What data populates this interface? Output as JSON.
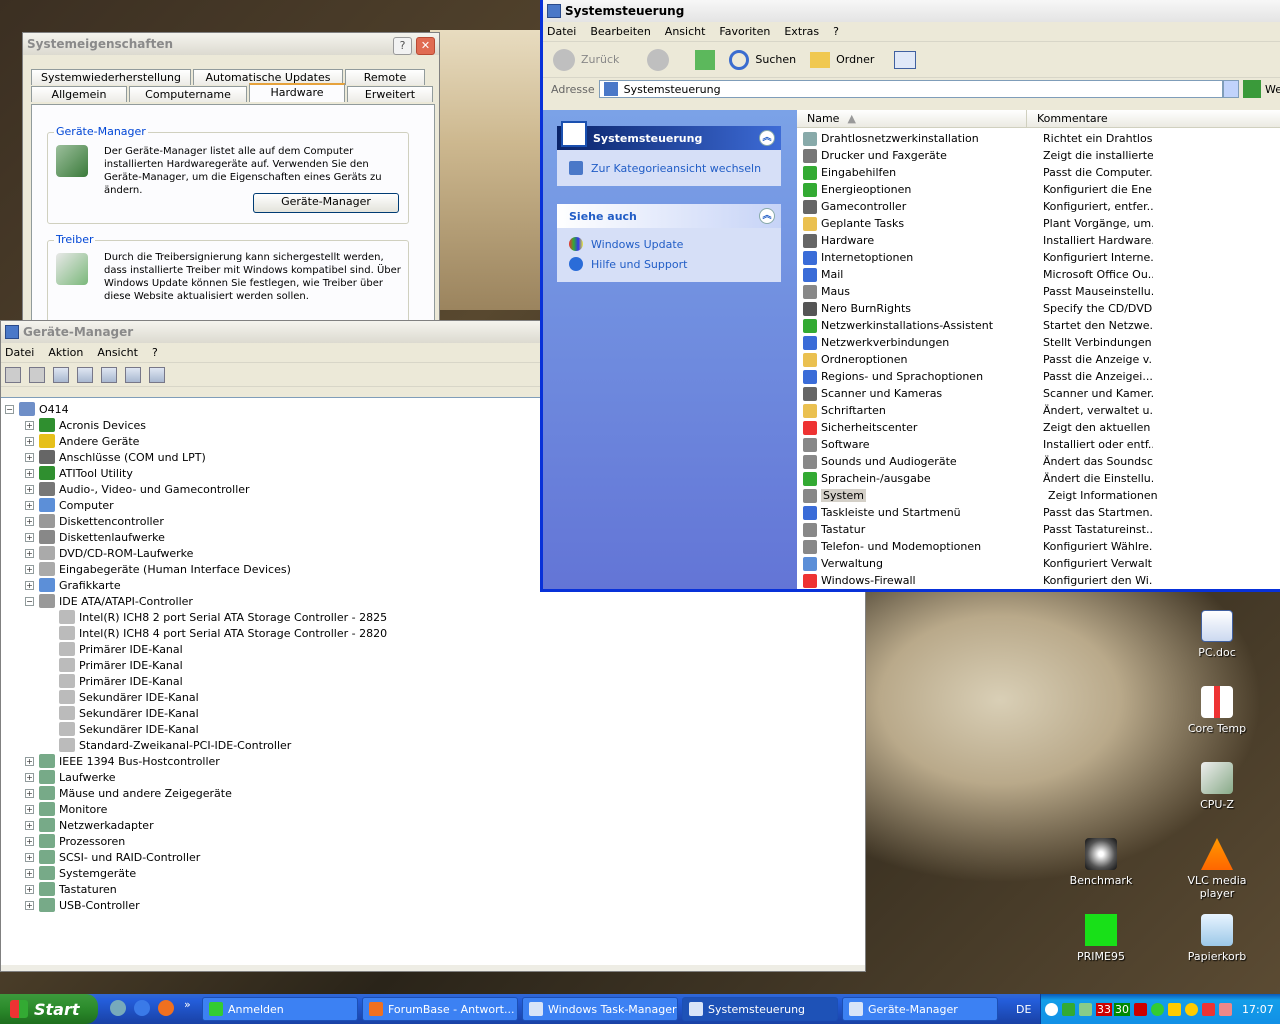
{
  "sysprops": {
    "title": "Systemeigenschaften",
    "tabs_row1": [
      "Systemwiederherstellung",
      "Automatische Updates",
      "Remote"
    ],
    "tabs_row2": [
      "Allgemein",
      "Computername",
      "Hardware",
      "Erweitert"
    ],
    "devmgr_legend": "Geräte-Manager",
    "devmgr_text": "Der Geräte-Manager listet alle auf dem Computer installierten Hardwaregeräte auf. Verwenden Sie den Geräte-Manager, um die Eigenschaften eines Geräts zu ändern.",
    "devmgr_button": "Geräte-Manager",
    "driver_legend": "Treiber",
    "driver_text": "Durch die Treibersignierung kann sichergestellt werden, dass installierte Treiber mit Windows kompatibel sind. Über Windows Update können Sie festlegen, wie Treiber über diese Website aktualisiert werden sollen."
  },
  "devmgr": {
    "title": "Geräte-Manager",
    "menu": [
      "Datei",
      "Aktion",
      "Ansicht",
      "?"
    ],
    "root": "O414",
    "top_categories": [
      "Acronis Devices",
      "Andere Geräte",
      "Anschlüsse (COM und LPT)",
      "ATITool Utility",
      "Audio-, Video- und Gamecontroller",
      "Computer",
      "Diskettencontroller",
      "Diskettenlaufwerke",
      "DVD/CD-ROM-Laufwerke",
      "Eingabegeräte (Human Interface Devices)",
      "Grafikkarte",
      "IDE ATA/ATAPI-Controller"
    ],
    "ide_children": [
      "Intel(R) ICH8 2 port Serial ATA Storage Controller - 2825",
      "Intel(R) ICH8 4 port Serial ATA Storage Controller - 2820",
      "Primärer IDE-Kanal",
      "Primärer IDE-Kanal",
      "Primärer IDE-Kanal",
      "Sekundärer IDE-Kanal",
      "Sekundärer IDE-Kanal",
      "Sekundärer IDE-Kanal",
      "Standard-Zweikanal-PCI-IDE-Controller"
    ],
    "bottom_categories": [
      "IEEE 1394 Bus-Hostcontroller",
      "Laufwerke",
      "Mäuse und andere Zeigegeräte",
      "Monitore",
      "Netzwerkadapter",
      "Prozessoren",
      "SCSI- und RAID-Controller",
      "Systemgeräte",
      "Tastaturen",
      "USB-Controller"
    ]
  },
  "cp": {
    "title": "Systemsteuerung",
    "menu": [
      "Datei",
      "Bearbeiten",
      "Ansicht",
      "Favoriten",
      "Extras",
      "?"
    ],
    "back": "Zurück",
    "search": "Suchen",
    "folders": "Ordner",
    "address_label": "Adresse",
    "address": "Systemsteuerung",
    "go": "We",
    "panel_title": "Systemsteuerung",
    "panel_link": "Zur Kategorieansicht wechseln",
    "see_also": "Siehe auch",
    "see_also_items": [
      "Windows Update",
      "Hilfe und Support"
    ],
    "col_name": "Name",
    "col_comment": "Kommentare",
    "items": [
      {
        "name": "Drahtlosnetzwerkinstallation",
        "comment": "Richtet ein Drahtlos..."
      },
      {
        "name": "Drucker und Faxgeräte",
        "comment": "Zeigt die installierte..."
      },
      {
        "name": "Eingabehilfen",
        "comment": "Passt die Computer..."
      },
      {
        "name": "Energieoptionen",
        "comment": "Konfiguriert die Ene..."
      },
      {
        "name": "Gamecontroller",
        "comment": "Konfiguriert, entfer..."
      },
      {
        "name": "Geplante Tasks",
        "comment": "Plant Vorgänge, um..."
      },
      {
        "name": "Hardware",
        "comment": "Installiert Hardware..."
      },
      {
        "name": "Internetoptionen",
        "comment": "Konfiguriert Interne..."
      },
      {
        "name": "Mail",
        "comment": "Microsoft Office Ou..."
      },
      {
        "name": "Maus",
        "comment": "Passt Mauseinstellu..."
      },
      {
        "name": "Nero BurnRights",
        "comment": "Specify the CD/DVD..."
      },
      {
        "name": "Netzwerkinstallations-Assistent",
        "comment": "Startet den Netzwe..."
      },
      {
        "name": "Netzwerkverbindungen",
        "comment": "Stellt Verbindungen ..."
      },
      {
        "name": "Ordneroptionen",
        "comment": "Passt die Anzeige v..."
      },
      {
        "name": "Regions- und Sprachoptionen",
        "comment": "Passt die Anzeigei..."
      },
      {
        "name": "Scanner und Kameras",
        "comment": "Scanner und Kamer..."
      },
      {
        "name": "Schriftarten",
        "comment": "Ändert, verwaltet u..."
      },
      {
        "name": "Sicherheitscenter",
        "comment": "Zeigt den aktuellen ..."
      },
      {
        "name": "Software",
        "comment": "Installiert oder entf..."
      },
      {
        "name": "Sounds und Audiogeräte",
        "comment": "Ändert das Soundsc..."
      },
      {
        "name": "Sprachein-/ausgabe",
        "comment": "Ändert die Einstellu..."
      },
      {
        "name": "System",
        "comment": "Zeigt Informationen..."
      },
      {
        "name": "Taskleiste und Startmenü",
        "comment": "Passt das Startmen..."
      },
      {
        "name": "Tastatur",
        "comment": "Passt Tastatureinst..."
      },
      {
        "name": "Telefon- und Modemoptionen",
        "comment": "Konfiguriert Wählre..."
      },
      {
        "name": "Verwaltung",
        "comment": "Konfiguriert Verwalt..."
      },
      {
        "name": "Windows-Firewall",
        "comment": "Konfiguriert den Wi..."
      }
    ]
  },
  "desktop_icons": [
    "PC.doc",
    "Core Temp",
    "CPU-Z",
    "Benchmark",
    "VLC media player",
    "PRIME95",
    "Papierkorb"
  ],
  "taskbar": {
    "start": "Start",
    "tasks": [
      "Anmelden",
      "ForumBase - Antwort...",
      "Windows Task-Manager",
      "Systemsteuerung",
      "Geräte-Manager"
    ],
    "lang": "DE",
    "tray_nums": [
      "33",
      "30"
    ],
    "clock": "17:07"
  }
}
